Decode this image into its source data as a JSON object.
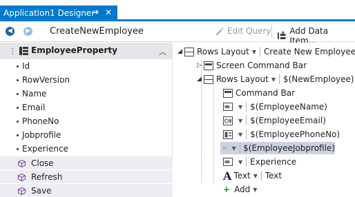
{
  "tab": {
    "title": "Application1 Designer*",
    "pin_glyph": "⊸",
    "close_glyph": "✕"
  },
  "toolbar": {
    "screen_name": "CreateNewEmployee",
    "edit_query_label": "Edit Query",
    "add_data_item_label": "Add Data Item..."
  },
  "entity": {
    "title": "EmployeeProperty",
    "properties": [
      "Id",
      "RowVersion",
      "Name",
      "Email",
      "PhoneNo",
      "Jobprofile",
      "Experience"
    ],
    "methods": [
      "Close",
      "Refresh",
      "Save"
    ]
  },
  "tree": {
    "root_label": "Rows Layout",
    "root_value": "Create New Employee",
    "screen_command_bar": "Screen Command Bar",
    "rows_label": "Rows Layout",
    "rows_value": "$(NewEmployee)",
    "command_bar": "Command Bar",
    "fields": [
      {
        "value": "$(EmployeeName)"
      },
      {
        "value": "$(EmployeeEmail)"
      },
      {
        "value": "$(EmployeePhoneNo)"
      },
      {
        "value": "$(EmployeeJobprofile)"
      },
      {
        "value": "Experience"
      }
    ],
    "text_label": "Text",
    "text_value": "Text",
    "add_label": "Add"
  }
}
